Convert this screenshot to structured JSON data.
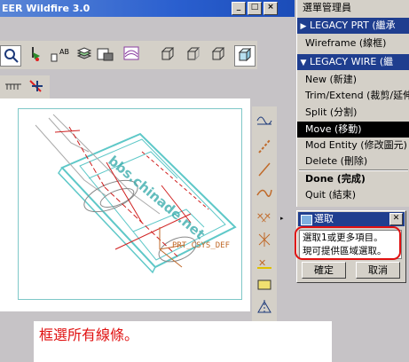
{
  "window": {
    "title": "EER Wildfire 3.0",
    "buttons": [
      "_",
      "□",
      "×"
    ]
  },
  "toolbar": {
    "icons": [
      "zoom-icon",
      "view-orient-icon",
      "annotation-label-icon",
      "layers-icon",
      "saved-view-icon",
      "spin-center-icon",
      "wireframe-icon",
      "hidden-line-icon",
      "no-hidden-icon",
      "shading-icon"
    ],
    "annotation_label": "AB"
  },
  "menu_manager": {
    "title": "選單管理員",
    "legacy_prt_label": "LEGACY PRT (繼承",
    "wireframe_label": "Wireframe (線框)",
    "legacy_wire_label": "LEGACY WIRE (繼",
    "items": [
      {
        "label": "New (新建)"
      },
      {
        "label": "Trim/Extend (裁剪/延伸"
      },
      {
        "label": "Split (分割)"
      },
      {
        "label": "Move (移動)"
      },
      {
        "label": "Mod Entity (修改圖元)"
      },
      {
        "label": "Delete (刪除)"
      }
    ],
    "done_label": "Done (完成)",
    "quit_label": "Quit (結束)"
  },
  "select_dialog": {
    "title": "選取",
    "message_line1": "選取1或更多項目。",
    "message_line2": "現可提供區域選取。",
    "ok_label": "確定",
    "cancel_label": "取消"
  },
  "canvas": {
    "csys_label": "PRT_CSYS_DEF"
  },
  "caption": "框選所有線條。",
  "watermark": "bbs.chinade.net",
  "colors": {
    "menu_header_bg": "#1f3e8f",
    "highlight_bg": "#000000",
    "callout": "#e01010",
    "geometry_cyan": "#5ec8c8",
    "geometry_red": "#d02020"
  }
}
